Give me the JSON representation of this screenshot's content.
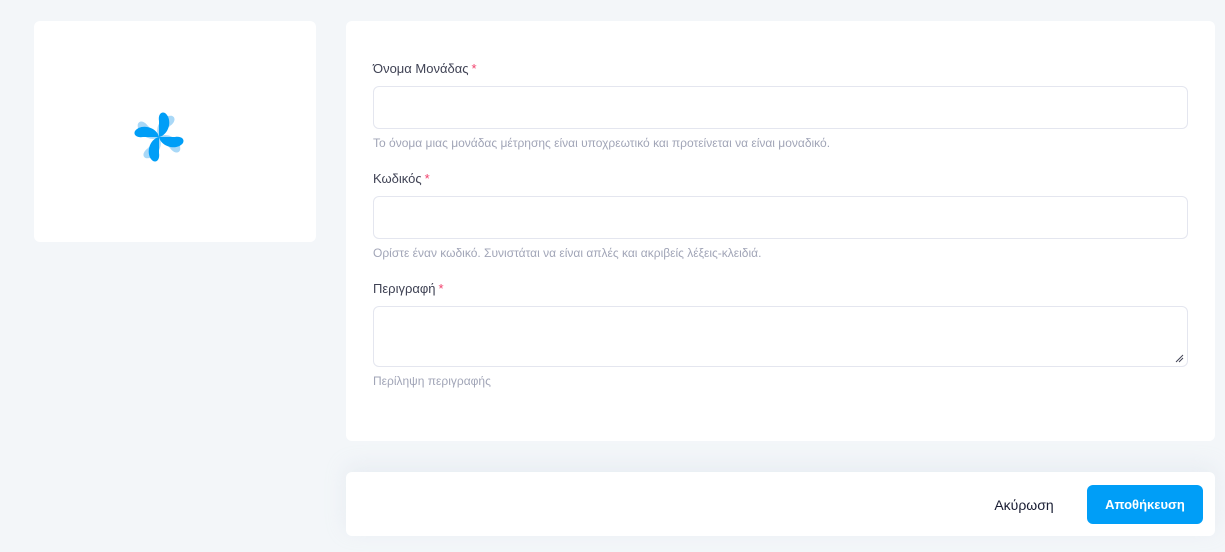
{
  "logo": {
    "icon": "blossom-logo-icon",
    "colors": {
      "primary": "#009ef7",
      "light": "#a9d8f7"
    }
  },
  "form": {
    "name": {
      "label": "Όνομα Μονάδας",
      "required_mark": "*",
      "value": "",
      "hint": "Το όνομα μιας μονάδας μέτρησης είναι υποχρεωτικό και προτείνεται να είναι μοναδικό."
    },
    "code": {
      "label": "Κωδικός",
      "required_mark": "*",
      "value": "",
      "hint": "Ορίστε έναν κωδικό. Συνιστάται να είναι απλές και ακριβείς λέξεις-κλειδιά."
    },
    "description": {
      "label": "Περιγραφή",
      "required_mark": "*",
      "value": "",
      "hint": "Περίληψη περιγραφής"
    }
  },
  "footer": {
    "cancel_label": "Ακύρωση",
    "save_label": "Αποθήκευση"
  },
  "colors": {
    "accent": "#009ef7",
    "required": "#f1416c",
    "background": "#f3f6f9"
  }
}
